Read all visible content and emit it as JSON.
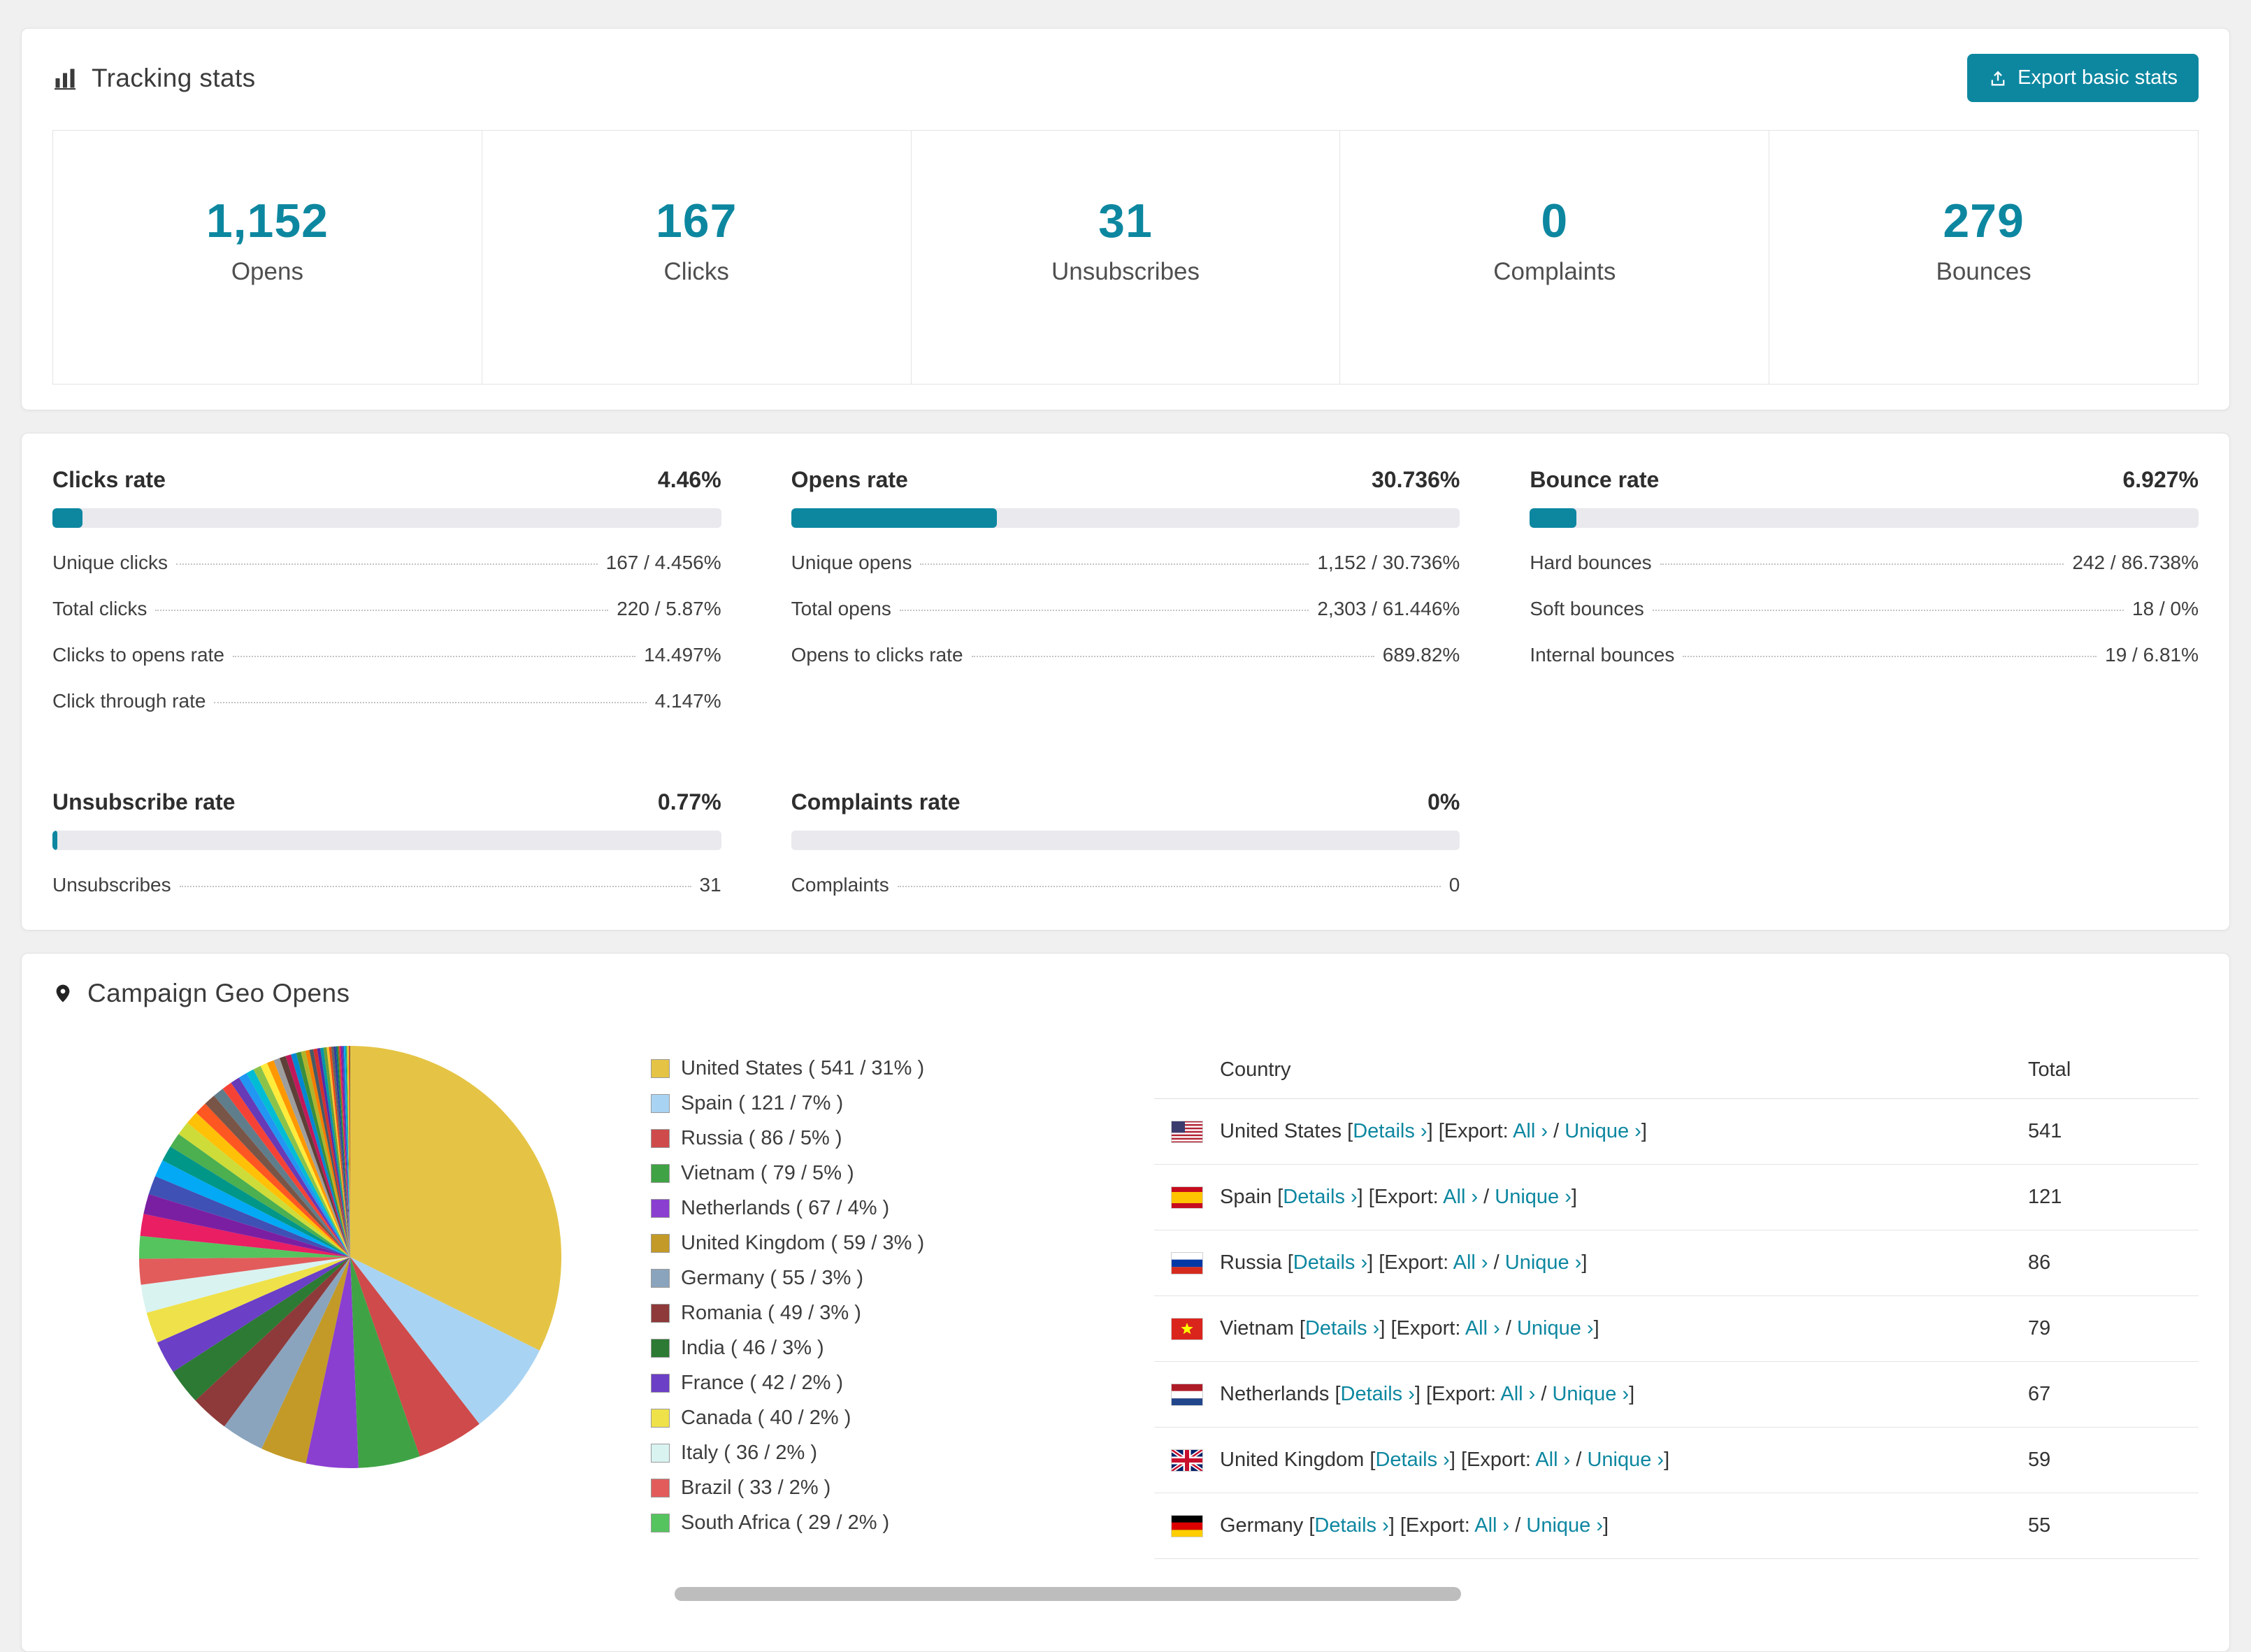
{
  "colors": {
    "accent": "#0d87a0"
  },
  "tracking": {
    "title": "Tracking stats",
    "export_button": "Export basic stats",
    "stats": [
      {
        "value": "1,152",
        "label": "Opens"
      },
      {
        "value": "167",
        "label": "Clicks"
      },
      {
        "value": "31",
        "label": "Unsubscribes"
      },
      {
        "value": "0",
        "label": "Complaints"
      },
      {
        "value": "279",
        "label": "Bounces"
      }
    ]
  },
  "rates": [
    {
      "title": "Clicks rate",
      "value": "4.46%",
      "pct": 4.46,
      "rows": [
        {
          "label": "Unique clicks",
          "value": "167 / 4.456%"
        },
        {
          "label": "Total clicks",
          "value": "220 / 5.87%"
        },
        {
          "label": "Clicks to opens rate",
          "value": "14.497%"
        },
        {
          "label": "Click through rate",
          "value": "4.147%"
        }
      ]
    },
    {
      "title": "Opens rate",
      "value": "30.736%",
      "pct": 30.736,
      "rows": [
        {
          "label": "Unique opens",
          "value": "1,152 / 30.736%"
        },
        {
          "label": "Total opens",
          "value": "2,303 / 61.446%"
        },
        {
          "label": "Opens to clicks rate",
          "value": "689.82%"
        }
      ]
    },
    {
      "title": "Bounce rate",
      "value": "6.927%",
      "pct": 6.927,
      "rows": [
        {
          "label": "Hard bounces",
          "value": "242 / 86.738%"
        },
        {
          "label": "Soft bounces",
          "value": "18 / 0%"
        },
        {
          "label": "Internal bounces",
          "value": "19 / 6.81%"
        }
      ]
    },
    {
      "title": "Unsubscribe rate",
      "value": "0.77%",
      "pct": 0.77,
      "rows": [
        {
          "label": "Unsubscribes",
          "value": "31"
        }
      ]
    },
    {
      "title": "Complaints rate",
      "value": "0%",
      "pct": 0,
      "rows": [
        {
          "label": "Complaints",
          "value": "0"
        }
      ]
    }
  ],
  "geo": {
    "title": "Campaign Geo Opens",
    "columns": {
      "country": "Country",
      "total": "Total"
    },
    "links": {
      "details": "Details",
      "export": "Export:",
      "all": "All",
      "unique": "Unique",
      "arrow": "›"
    },
    "rows": [
      {
        "country": "United States",
        "flag": "us",
        "total": "541"
      },
      {
        "country": "Spain",
        "flag": "es",
        "total": "121"
      },
      {
        "country": "Russia",
        "flag": "ru",
        "total": "86"
      },
      {
        "country": "Vietnam",
        "flag": "vn",
        "total": "79"
      },
      {
        "country": "Netherlands",
        "flag": "nl",
        "total": "67"
      },
      {
        "country": "United Kingdom",
        "flag": "gb",
        "total": "59"
      },
      {
        "country": "Germany",
        "flag": "de",
        "total": "55"
      }
    ]
  },
  "chart_data": {
    "type": "pie",
    "title": "Campaign Geo Opens",
    "legend_position": "right",
    "slices": [
      {
        "label": "United States",
        "value": 541,
        "pct": 31,
        "color": "#e5c445"
      },
      {
        "label": "Spain",
        "value": 121,
        "pct": 7,
        "color": "#a9d3f2"
      },
      {
        "label": "Russia",
        "value": 86,
        "pct": 5,
        "color": "#cf4a4a"
      },
      {
        "label": "Vietnam",
        "value": 79,
        "pct": 5,
        "color": "#3fa345"
      },
      {
        "label": "Netherlands",
        "value": 67,
        "pct": 4,
        "color": "#8a3fd1"
      },
      {
        "label": "United Kingdom",
        "value": 59,
        "pct": 3,
        "color": "#c39a27"
      },
      {
        "label": "Germany",
        "value": 55,
        "pct": 3,
        "color": "#8aa4bd"
      },
      {
        "label": "Romania",
        "value": 49,
        "pct": 3,
        "color": "#8e3a3a"
      },
      {
        "label": "India",
        "value": 46,
        "pct": 3,
        "color": "#2c7a33"
      },
      {
        "label": "France",
        "value": 42,
        "pct": 2,
        "color": "#6b3fc6"
      },
      {
        "label": "Canada",
        "value": 40,
        "pct": 2,
        "color": "#efe14a"
      },
      {
        "label": "Italy",
        "value": 36,
        "pct": 2,
        "color": "#d9f3f1"
      },
      {
        "label": "Brazil",
        "value": 33,
        "pct": 2,
        "color": "#e25c5c"
      },
      {
        "label": "South Africa",
        "value": 29,
        "pct": 2,
        "color": "#55c45e"
      }
    ],
    "unlabeled_slivers": {
      "note": "many additional small countries rendered as thin unlabeled slices",
      "values": [
        28,
        26,
        24,
        22,
        20,
        19,
        18,
        17,
        16,
        15,
        14,
        13,
        12,
        11,
        10,
        10,
        9,
        9,
        8,
        8,
        7,
        7,
        6,
        6,
        5,
        5,
        5,
        4,
        4,
        4,
        3,
        3,
        3,
        3,
        2,
        2,
        2,
        2,
        2,
        2,
        1,
        1,
        1,
        1,
        1,
        1
      ],
      "colors": [
        "#e91e63",
        "#7b1fa2",
        "#3f51b5",
        "#03a9f4",
        "#009688",
        "#4caf50",
        "#cddc39",
        "#ffc107",
        "#ff5722",
        "#795548",
        "#607d8b",
        "#f44336",
        "#673ab7",
        "#2196f3",
        "#00bcd4",
        "#8bc34a",
        "#ffeb3b",
        "#ff9800",
        "#9e9e9e",
        "#5d4037",
        "#c2185b",
        "#0288d1",
        "#388e3c",
        "#afb42b",
        "#f57c00",
        "#455a64",
        "#d32f2f",
        "#512da8",
        "#0097a7",
        "#689f38",
        "#fbc02d",
        "#e64a19",
        "#616161",
        "#303f9f",
        "#00796b",
        "#827717"
      ]
    }
  }
}
